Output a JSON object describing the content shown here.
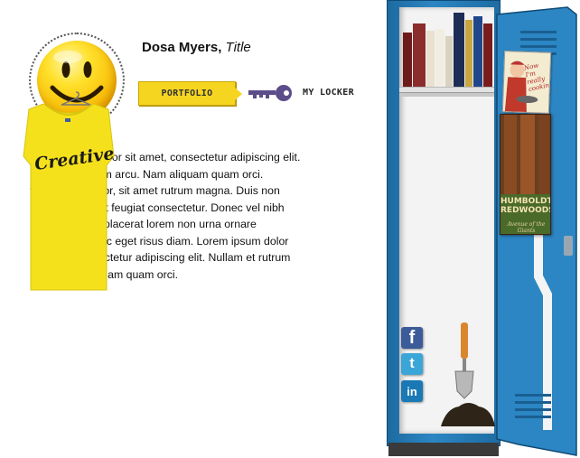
{
  "profile": {
    "name": "Dosa Myers,",
    "title": "Title",
    "bio": "Lorem ipsum dolor sit amet, consectetur adipiscing elit.\nNullam et rutrum arcu. Nam aliquam quam orci.\nteger eu mi dolor, sit amet rutrum magna. Duis non\nlectus vitae velit feugiat consectetur. Donec vel nibh\nacus. stibulum placerat lorem non urna ornare\n hendrerit. Donec eget risus diam. Lorem ipsum dolor\nsit amet, consectetur adipiscing elit. Nullam et rutrum\narcu. Nam aliquam quam orci."
  },
  "nav": {
    "portfolio_label": "PORTFOLIO",
    "locker_label": "MY LOCKER"
  },
  "locker": {
    "shirt_text": "Creative",
    "poster1_text": "Now I'm really cooking!",
    "poster2_title": "HUMBOLDT REDWOODS",
    "poster2_sub": "Avenue of the Giants",
    "social": {
      "facebook": "f",
      "twitter": "t",
      "linkedin": "in"
    }
  },
  "colors": {
    "locker_blue": "#2c86c3",
    "button_yellow": "#f6d520",
    "key_purple": "#5b4c8a",
    "shirt_yellow": "#f5e11b"
  }
}
